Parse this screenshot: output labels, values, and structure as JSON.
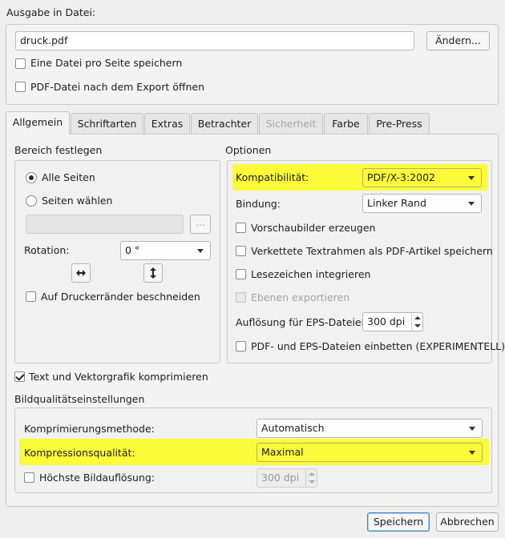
{
  "output": {
    "section_label": "Ausgabe in Datei:",
    "filename": "druck.pdf",
    "change_button": "Ändern...",
    "one_file_per_page": "Eine Datei pro Seite speichern",
    "open_after_export": "PDF-Datei nach dem Export öffnen"
  },
  "tabs": [
    {
      "label": "Allgemein",
      "active": true
    },
    {
      "label": "Schriftarten",
      "active": false
    },
    {
      "label": "Extras",
      "active": false
    },
    {
      "label": "Betrachter",
      "active": false
    },
    {
      "label": "Sicherheit",
      "active": false,
      "disabled": true
    },
    {
      "label": "Farbe",
      "active": false
    },
    {
      "label": "Pre-Press",
      "active": false
    }
  ],
  "range": {
    "title": "Bereich festlegen",
    "all_pages": "Alle Seiten",
    "choose_pages": "Seiten wählen",
    "pages_value": "",
    "browse_button": "...",
    "rotation_label": "Rotation:",
    "rotation_value": "0 °",
    "crop_label": "Auf Druckerränder beschneiden",
    "flip_h_icon": "flip-horizontal-icon",
    "flip_v_icon": "flip-vertical-icon"
  },
  "options": {
    "title": "Optionen",
    "compat_label": "Kompatibilität:",
    "compat_value": "PDF/X-3:2002",
    "binding_label": "Bindung:",
    "binding_value": "Linker Rand",
    "thumbnails": "Vorschaubilder erzeugen",
    "linked_frames": "Verkettete Textrahmen als PDF-Artikel speichern",
    "bookmarks": "Lesezeichen integrieren",
    "export_layers": "Ebenen exportieren",
    "eps_resolution_label": "Auflösung für EPS-Dateien:",
    "eps_resolution_value": "300 dpi",
    "embed_pdf_eps": "PDF- und EPS-Dateien einbetten (EXPERIMENTELL)"
  },
  "compress_text": "Text und Vektorgrafik komprimieren",
  "image_quality": {
    "title": "Bildqualitätseinstellungen",
    "method_label": "Komprimierungsmethode:",
    "method_value": "Automatisch",
    "quality_label": "Kompressionsqualität:",
    "quality_value": "Maximal",
    "max_resolution_label": "Höchste Bildauflösung:",
    "max_resolution_value": "300 dpi"
  },
  "footer": {
    "save_button": "Speichern",
    "cancel_button": "Abbrechen"
  },
  "colors": {
    "highlight": "#fbfb3a",
    "primary_border": "#3f83c6"
  }
}
